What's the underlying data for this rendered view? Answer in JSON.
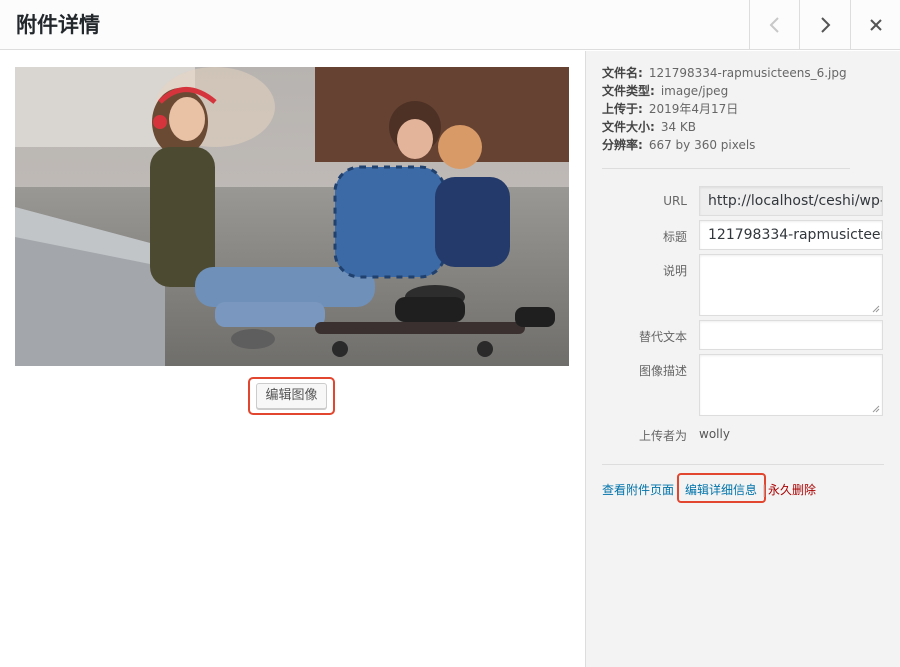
{
  "header": {
    "title": "附件详情",
    "prev_icon": "chevron-left-icon",
    "next_icon": "chevron-right-icon",
    "close_icon": "close-icon"
  },
  "preview": {
    "edit_image_label": "编辑图像"
  },
  "details": {
    "file_name_label": "文件名:",
    "file_name": "121798334-rapmusicteens_6.jpg",
    "file_type_label": "文件类型:",
    "file_type": "image/jpeg",
    "uploaded_on_label": "上传于:",
    "uploaded_on": "2019年4月17日",
    "file_size_label": "文件大小:",
    "file_size": "34 KB",
    "dimensions_label": "分辨率:",
    "dimensions": "667 by 360 pixels"
  },
  "form": {
    "url_label": "URL",
    "url_value": "http://localhost/ceshi/wp-",
    "title_label": "标题",
    "title_value": "121798334-rapmusicteen",
    "caption_label": "说明",
    "alt_label": "替代文本",
    "description_label": "图像描述",
    "uploaded_by_label": "上传者为",
    "uploaded_by": "wolly"
  },
  "actions": {
    "view_page": "查看附件页面",
    "edit_details": "编辑详细信息",
    "separator": "|",
    "delete": "永久删除"
  },
  "colors": {
    "link": "#0073aa",
    "delete": "#a00",
    "highlight": "#e2462f"
  }
}
